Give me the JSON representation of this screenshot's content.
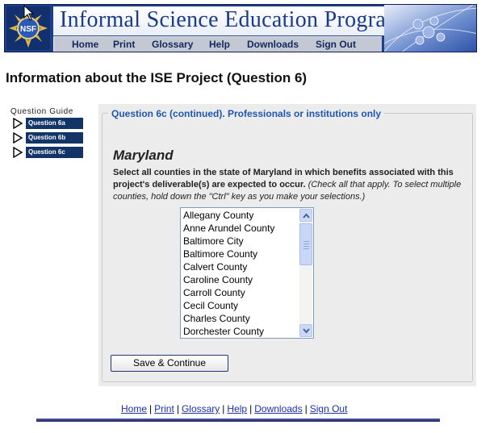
{
  "header": {
    "title": "Informal Science Education Program",
    "logo_text": "NSF",
    "nav": [
      "Home",
      "Print",
      "Glossary",
      "Help",
      "Downloads",
      "Sign Out"
    ]
  },
  "page_title": "Information about the ISE Project (Question 6)",
  "guide": {
    "label": "Question Guide",
    "items": [
      "Question 6a",
      "Question 6b",
      "Question 6c"
    ]
  },
  "form": {
    "legend": "Question 6c (continued).  Professionals or institutions only",
    "state": "Maryland",
    "instruction_bold": "Select all counties in the state of Maryland in which benefits associated with this project's deliverable(s) are expected to occur.",
    "instruction_italic": "(Check all that apply. To select multiple counties, hold down the \"Ctrl\" key as you make your selections.)",
    "counties": [
      "Allegany County",
      "Anne Arundel County",
      "Baltimore City",
      "Baltimore County",
      "Calvert County",
      "Caroline County",
      "Carroll County",
      "Cecil County",
      "Charles County",
      "Dorchester County"
    ],
    "submit_label": "Save & Continue"
  },
  "footer": {
    "links": [
      "Home",
      "Print",
      "Glossary",
      "Help",
      "Downloads",
      "Sign Out"
    ]
  },
  "colors": {
    "banner_blue": "#1d3f8a",
    "legend_blue": "#1f56b0",
    "guide_navy": "#123466",
    "panel_gray": "#ececec"
  }
}
